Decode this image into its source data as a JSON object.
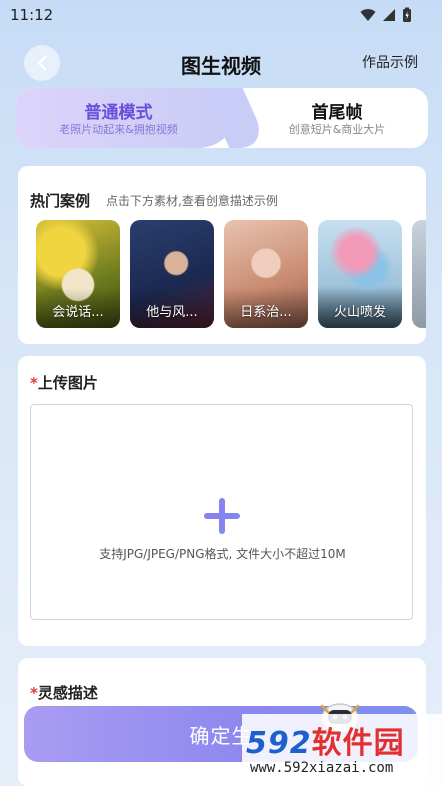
{
  "status_bar": {
    "time": "11:12"
  },
  "header": {
    "title": "图生视频",
    "examples_link": "作品示例"
  },
  "mode_tabs": [
    {
      "title": "普通模式",
      "subtitle": "老照片动起来&拥抱视频",
      "active": true
    },
    {
      "title": "首尾帧",
      "subtitle": "创意短片&商业大片",
      "active": false
    }
  ],
  "hot_cases": {
    "title": "热门案例",
    "description": "点击下方素材,查看创意描述示例",
    "items": [
      {
        "label": "会说话..."
      },
      {
        "label": "他与风..."
      },
      {
        "label": "日系治..."
      },
      {
        "label": "火山喷发"
      }
    ]
  },
  "upload": {
    "required_mark": "*",
    "label": "上传图片",
    "hint": "支持JPG/JPEG/PNG格式, 文件大小不超过10M"
  },
  "inspiration": {
    "required_mark": "*",
    "label": "灵感描述"
  },
  "confirm_button": {
    "label": "确定生"
  },
  "watermark": {
    "logo_number": "592",
    "logo_text": "软件园",
    "url": "www.592xiazai.com"
  },
  "colors": {
    "accent": "#6a4fd8",
    "required": "#e33b3b",
    "button": "#8c86ee"
  }
}
